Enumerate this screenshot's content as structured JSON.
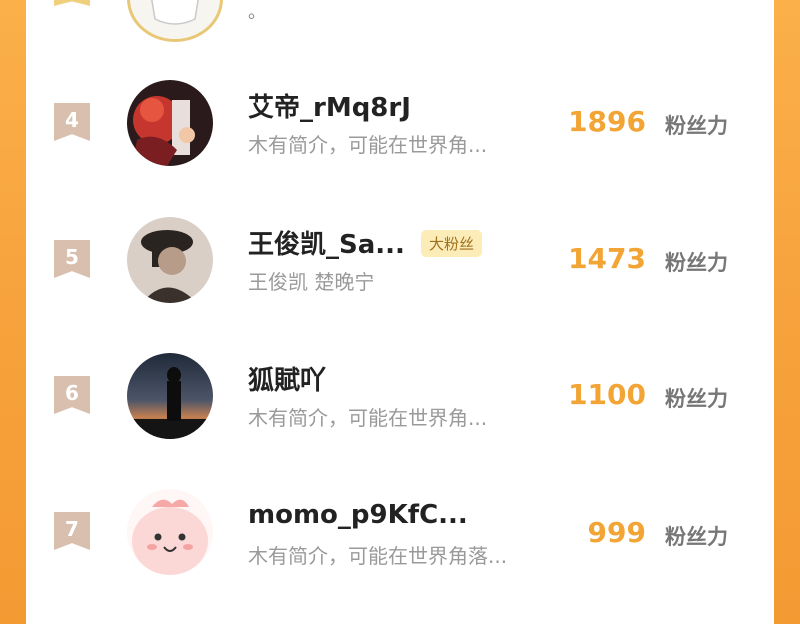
{
  "top_partial": {
    "text": "。"
  },
  "entries": [
    {
      "rank": "4",
      "name": "艾帝_rMq8rJ",
      "desc": "木有简介，可能在世界角...",
      "badge": "",
      "score": "1896",
      "unit": "粉丝力",
      "avatar": "anime-character-avatar"
    },
    {
      "rank": "5",
      "name": "王俊凯_Sa...",
      "desc": "王俊凯 楚晚宁",
      "badge": "大粉丝",
      "score": "1473",
      "unit": "粉丝力",
      "avatar": "person-in-hat-avatar"
    },
    {
      "rank": "6",
      "name": "狐賦吖",
      "desc": "木有简介，可能在世界角...",
      "badge": "",
      "score": "1100",
      "unit": "粉丝力",
      "avatar": "sunset-silhouette-avatar"
    },
    {
      "rank": "7",
      "name": "momo_p9KfC...",
      "desc": "木有简介，可能在世界角落...",
      "badge": "",
      "score": "999",
      "unit": "粉丝力",
      "avatar": "pink-cartoon-avatar"
    }
  ],
  "colors": {
    "accent_orange": "#f2a535",
    "side_orange": "#f7a23c",
    "rank_badge": "#d8bfae",
    "badge_bg": "#fbecb8"
  }
}
